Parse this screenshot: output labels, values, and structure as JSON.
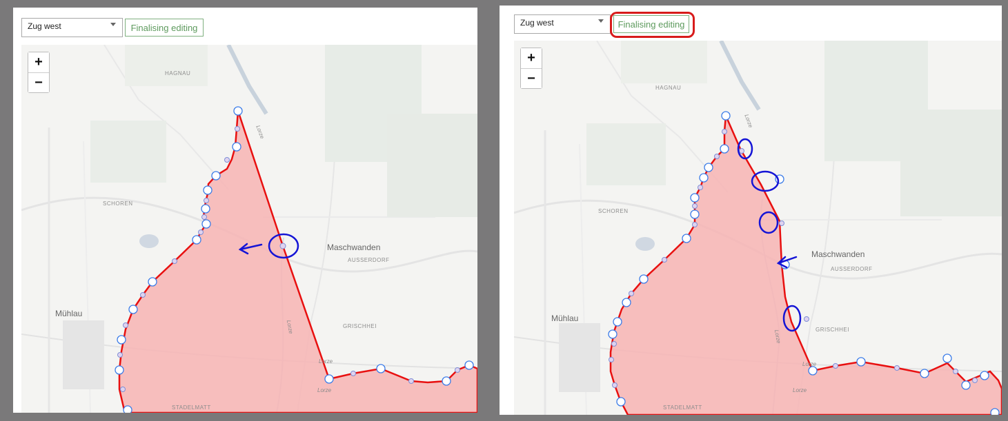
{
  "panels": [
    {
      "layer_select": {
        "value": "Zug west"
      },
      "finish_button": {
        "label": "Finalising editing"
      },
      "zoom": {
        "in": "+",
        "out": "−"
      },
      "places": {
        "hagnau": "HAGNAU",
        "schoren": "SCHOREN",
        "muehlau": "Mühlau",
        "maschwanden": "Maschwanden",
        "ausserdorf": "AUSSERDORF",
        "grischhei": "GRISCHHEI",
        "stadelmatt": "STADELMATT",
        "lorze_1": "Lorze",
        "lorze_2": "Lorze",
        "lorze_3": "Lorze",
        "lorze_4": "Lorze"
      }
    },
    {
      "layer_select": {
        "value": "Zug west"
      },
      "finish_button": {
        "label": "Finalising editing"
      },
      "zoom": {
        "in": "+",
        "out": "−"
      },
      "places": {
        "hagnau": "HAGNAU",
        "schoren": "SCHOREN",
        "muehlau": "Mühlau",
        "maschwanden": "Maschwanden",
        "ausserdorf": "AUSSERDORF",
        "grischhei": "GRISCHHEI",
        "stadelmatt": "STADELMATT",
        "lorze_1": "Lorze",
        "lorze_2": "Lorze",
        "lorze_3": "Lorze",
        "lorze_4": "Lorze"
      }
    }
  ],
  "colors": {
    "polygon_fill": "#f7b4b4",
    "polygon_stroke": "#e81010",
    "annotation": "#1414d6",
    "highlight": "#d81b1b",
    "button_text": "#5d9a5d"
  }
}
